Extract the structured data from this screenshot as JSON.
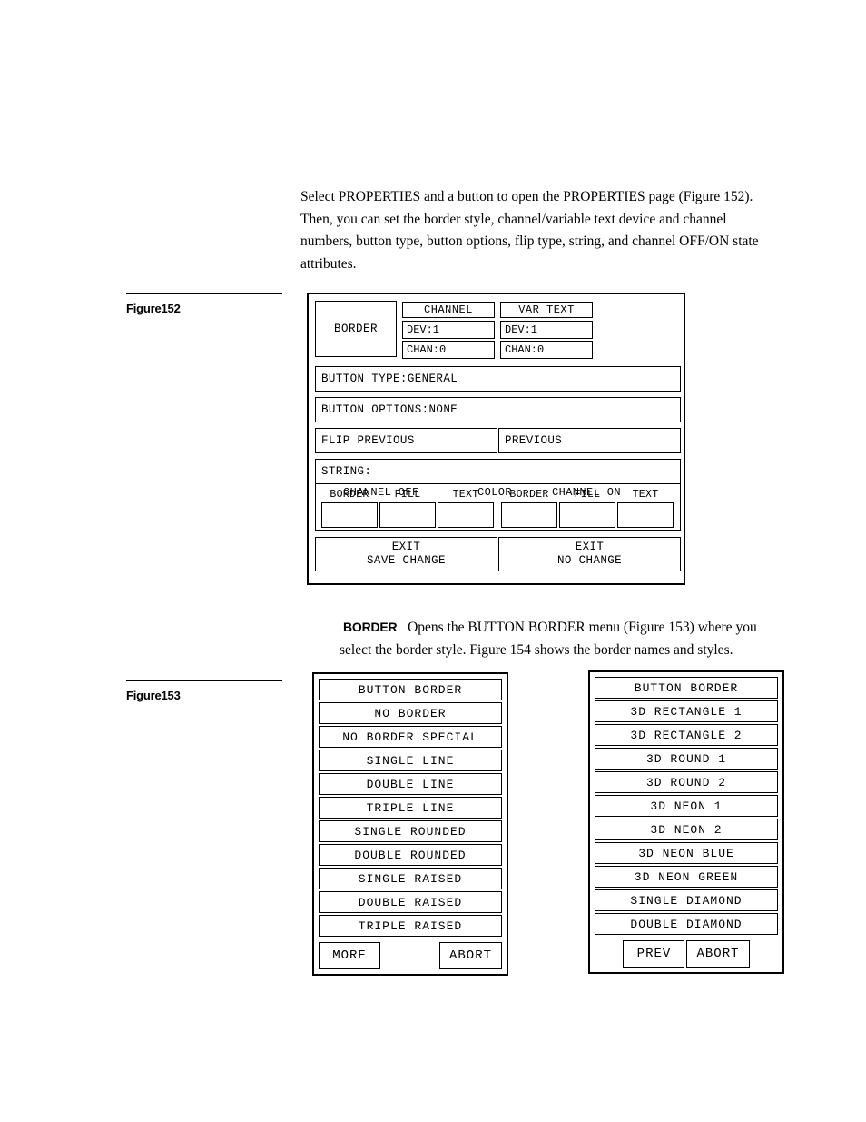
{
  "intro": {
    "lines": [
      "Select PROPERTIES and a button to open the PROPERTIES page (Figure 152).",
      "Then, you can set the border style, channel/variable text device and channel",
      "numbers, button type, button options, flip type, string, and channel OFF/ON state",
      "attributes."
    ]
  },
  "figures": {
    "fig152_caption": "Figure152",
    "fig153_caption": "Figure153"
  },
  "properties_page": {
    "border_button": "BORDER",
    "channel": {
      "header": "CHANNEL",
      "dev_label": "DEV:1",
      "chan_label": "CHAN:0"
    },
    "var_text": {
      "header": "VAR TEXT",
      "dev_label": "DEV:1",
      "chan_label": "CHAN:0"
    },
    "button_type": "BUTTON TYPE:GENERAL",
    "button_options": "BUTTON OPTIONS:NONE",
    "flip_type": "FLIP PREVIOUS",
    "flip_value": "PREVIOUS",
    "string": "STRING:",
    "color_section": {
      "channel_off": "CHANNEL OFF",
      "color": "COLOR",
      "channel_on": "CHANNEL ON",
      "off_swatches": [
        "BORDER",
        "FILL",
        "TEXT"
      ],
      "on_swatches": [
        "BORDER",
        "FILL",
        "TEXT"
      ]
    },
    "exit_save": {
      "line1": "EXIT",
      "line2": "SAVE CHANGE"
    },
    "exit_nochange": {
      "line1": "EXIT",
      "line2": "NO CHANGE"
    }
  },
  "border_description": {
    "term": "BORDER",
    "line1": "Opens the BUTTON BORDER menu (Figure 153) where you",
    "line2": "select the border style. Figure 154 shows the border names and styles."
  },
  "border_menu_page1": {
    "title": "BUTTON BORDER",
    "items": [
      "NO BORDER",
      "NO BORDER SPECIAL",
      "SINGLE LINE",
      "DOUBLE LINE",
      "TRIPLE LINE",
      "SINGLE ROUNDED",
      "DOUBLE ROUNDED",
      "SINGLE RAISED",
      "DOUBLE RAISED",
      "TRIPLE RAISED"
    ],
    "footer": {
      "left": "MORE",
      "right": "ABORT"
    }
  },
  "border_menu_page2": {
    "title": "BUTTON BORDER",
    "items": [
      "3D RECTANGLE 1",
      "3D RECTANGLE 2",
      "3D ROUND 1",
      "3D ROUND 2",
      "3D NEON 1",
      "3D NEON 2",
      "3D NEON BLUE",
      "3D NEON GREEN",
      "SINGLE DIAMOND",
      "DOUBLE DIAMOND"
    ],
    "footer": {
      "left": "PREV",
      "right": "ABORT"
    }
  }
}
